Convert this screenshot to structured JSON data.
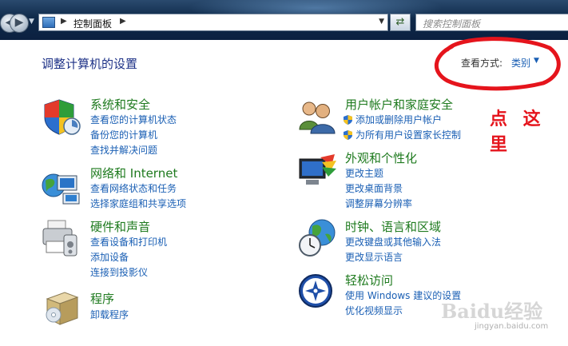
{
  "addressbar": {
    "breadcrumb": "控制面板",
    "search_placeholder": "搜索控制面板"
  },
  "header": {
    "title": "调整计算机的设置",
    "view_by_label": "查看方式:",
    "view_by_value": "类别"
  },
  "annotation": {
    "text": "点 这 里",
    "color": "#e5141c"
  },
  "categories": [
    {
      "title": "系统和安全",
      "links": [
        "查看您的计算机状态",
        "备份您的计算机",
        "查找并解决问题"
      ]
    },
    {
      "title": "网络和 Internet",
      "links": [
        "查看网络状态和任务",
        "选择家庭组和共享选项"
      ]
    },
    {
      "title": "硬件和声音",
      "links": [
        "查看设备和打印机",
        "添加设备",
        "连接到投影仪"
      ]
    },
    {
      "title": "程序",
      "links": [
        "卸载程序"
      ]
    },
    {
      "title": "用户帐户和家庭安全",
      "links": [
        "添加或删除用户帐户",
        "为所有用户设置家长控制"
      ]
    },
    {
      "title": "外观和个性化",
      "links": [
        "更改主题",
        "更改桌面背景",
        "调整屏幕分辨率"
      ]
    },
    {
      "title": "时钟、语言和区域",
      "links": [
        "更改键盘或其他输入法",
        "更改显示语言"
      ]
    },
    {
      "title": "轻松访问",
      "links": [
        "使用 Windows 建议的设置",
        "优化视频显示"
      ]
    }
  ],
  "watermark": {
    "brand": "Baidu经验",
    "url": "jingyan.baidu.com"
  },
  "colors": {
    "category_title": "#1e7a1e",
    "link": "#1a5fb4",
    "heading": "#1e3287"
  }
}
